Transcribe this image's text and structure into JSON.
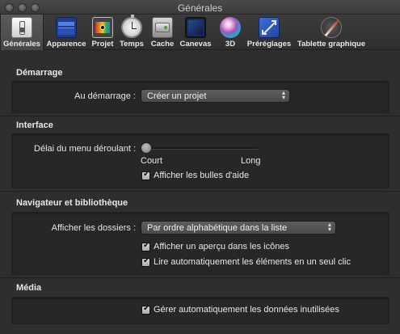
{
  "window": {
    "title": "Générales"
  },
  "toolbar": {
    "items": [
      {
        "label": "Générales",
        "icon": "switch-icon"
      },
      {
        "label": "Apparence",
        "icon": "appearance-icon"
      },
      {
        "label": "Projet",
        "icon": "film-icon"
      },
      {
        "label": "Temps",
        "icon": "stopwatch-icon"
      },
      {
        "label": "Cache",
        "icon": "cache-icon"
      },
      {
        "label": "Canevas",
        "icon": "canvas-icon"
      },
      {
        "label": "3D",
        "icon": "sphere-icon"
      },
      {
        "label": "Préréglages",
        "icon": "presets-icon"
      },
      {
        "label": "Tablette graphique",
        "icon": "stylus-icon"
      }
    ]
  },
  "startup": {
    "title": "Démarrage",
    "label": "Au démarrage :",
    "value": "Créer un projet"
  },
  "interface": {
    "title": "Interface",
    "delay_label": "Délai du menu déroulant :",
    "slider_min_label": "Court",
    "slider_max_label": "Long",
    "slider_value": 0.0,
    "tooltips_label": "Afficher les bulles d'aide",
    "tooltips_checked": true
  },
  "browser": {
    "title": "Navigateur et bibliothèque",
    "folders_label": "Afficher les dossiers :",
    "folders_value": "Par ordre alphabétique dans la liste",
    "preview_label": "Afficher un aperçu dans les icônes",
    "preview_checked": true,
    "autoplay_label": "Lire automatiquement les éléments en un seul clic",
    "autoplay_checked": true
  },
  "media": {
    "title": "Média",
    "manage_label": "Gérer automatiquement les données inutilisées",
    "manage_checked": true
  }
}
